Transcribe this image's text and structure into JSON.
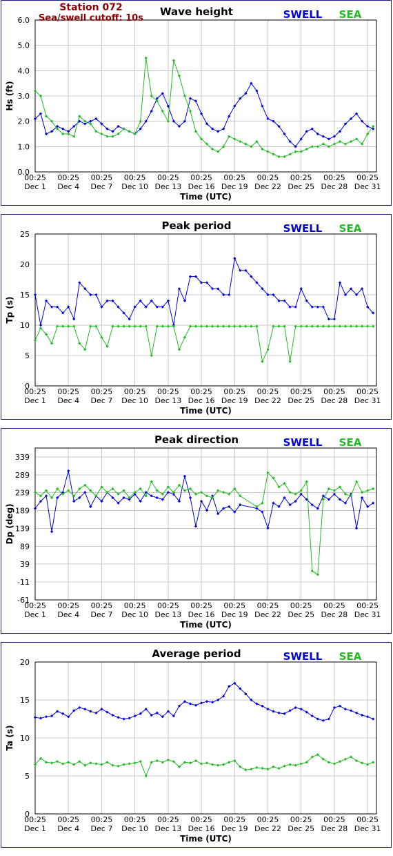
{
  "header": {
    "station": "Station 072",
    "cutoff": "Sea/swell cutoff: 10s"
  },
  "colors": {
    "swell": "#0000dd",
    "sea": "#22bb22"
  },
  "x_tick_labels": [
    [
      "00:25",
      "Dec 1"
    ],
    [
      "00:25",
      "Dec 4"
    ],
    [
      "00:25",
      "Dec 7"
    ],
    [
      "00:25",
      "Dec 10"
    ],
    [
      "00:25",
      "Dec 13"
    ],
    [
      "00:25",
      "Dec 16"
    ],
    [
      "00:25",
      "Dec 19"
    ],
    [
      "00:25",
      "Dec 22"
    ],
    [
      "00:25",
      "Dec 25"
    ],
    [
      "00:25",
      "Dec 28"
    ],
    [
      "00:25",
      "Dec 31"
    ]
  ],
  "chart_data": [
    {
      "type": "line",
      "title": "Wave height",
      "xlabel": "Time (UTC)",
      "ylabel": "Hs (ft)",
      "ylim": [
        0.0,
        6.0
      ],
      "yticks": [
        "0.0",
        "1.0",
        "2.0",
        "3.0",
        "4.0",
        "5.0",
        "6.0"
      ],
      "xlim": [
        0,
        30.8
      ],
      "grid": true,
      "legend": "top-right",
      "series": [
        {
          "name": "SWELL",
          "color": "#0000dd",
          "x": [
            0,
            0.5,
            1,
            1.5,
            2,
            2.5,
            3,
            3.5,
            4,
            4.5,
            5,
            5.5,
            6,
            6.5,
            7,
            7.5,
            8,
            8.5,
            9,
            9.5,
            10,
            10.5,
            11,
            11.5,
            12,
            12.5,
            13,
            13.5,
            14,
            14.5,
            15,
            15.5,
            16,
            16.5,
            17,
            17.5,
            18,
            18.5,
            19,
            19.5,
            20,
            20.5,
            21,
            21.5,
            22,
            22.5,
            23,
            23.5,
            24,
            24.5,
            25,
            25.5,
            26,
            26.5,
            27,
            27.5,
            28,
            28.5,
            29,
            29.5,
            30,
            30.5
          ],
          "y": [
            2.1,
            2.3,
            1.5,
            1.6,
            1.8,
            1.7,
            1.6,
            1.8,
            2.0,
            1.9,
            2.0,
            2.1,
            1.9,
            1.7,
            1.6,
            1.8,
            1.7,
            1.6,
            1.5,
            1.7,
            2.0,
            2.4,
            2.9,
            3.1,
            2.6,
            2.0,
            1.8,
            2.0,
            2.9,
            2.8,
            2.3,
            1.9,
            1.7,
            1.6,
            1.7,
            2.2,
            2.6,
            2.9,
            3.1,
            3.5,
            3.2,
            2.6,
            2.1,
            2.0,
            1.8,
            1.5,
            1.2,
            1.0,
            1.3,
            1.6,
            1.7,
            1.5,
            1.4,
            1.3,
            1.4,
            1.6,
            1.9,
            2.1,
            2.3,
            2.0,
            1.8,
            1.7
          ]
        },
        {
          "name": "SEA",
          "color": "#22bb22",
          "x": [
            0,
            0.5,
            1,
            1.5,
            2,
            2.5,
            3,
            3.5,
            4,
            4.5,
            5,
            5.5,
            6,
            6.5,
            7,
            7.5,
            8,
            8.5,
            9,
            9.5,
            10,
            10.5,
            11,
            11.5,
            12,
            12.5,
            13,
            13.5,
            14,
            14.5,
            15,
            15.5,
            16,
            16.5,
            17,
            17.5,
            18,
            18.5,
            19,
            19.5,
            20,
            20.5,
            21,
            21.5,
            22,
            22.5,
            23,
            23.5,
            24,
            24.5,
            25,
            25.5,
            26,
            26.5,
            27,
            27.5,
            28,
            28.5,
            29,
            29.5,
            30,
            30.5
          ],
          "y": [
            3.2,
            3.0,
            2.2,
            2.0,
            1.7,
            1.5,
            1.5,
            1.4,
            2.2,
            2.0,
            1.9,
            1.6,
            1.5,
            1.4,
            1.4,
            1.5,
            1.7,
            1.6,
            1.5,
            2.0,
            4.5,
            3.0,
            2.8,
            2.4,
            2.0,
            4.4,
            3.8,
            3.0,
            2.4,
            1.6,
            1.3,
            1.1,
            0.9,
            0.8,
            1.0,
            1.4,
            1.3,
            1.2,
            1.1,
            1.0,
            1.2,
            0.9,
            0.8,
            0.7,
            0.6,
            0.6,
            0.7,
            0.8,
            0.8,
            0.9,
            1.0,
            1.0,
            1.1,
            1.0,
            1.1,
            1.2,
            1.1,
            1.2,
            1.3,
            1.1,
            1.5,
            1.8
          ]
        }
      ]
    },
    {
      "type": "line",
      "title": "Peak period",
      "xlabel": "Time (UTC)",
      "ylabel": "Tp (s)",
      "ylim": [
        0,
        25
      ],
      "yticks": [
        "0",
        "5",
        "10",
        "15",
        "20",
        "25"
      ],
      "xlim": [
        0,
        30.8
      ],
      "grid": true,
      "legend": "top-right",
      "series": [
        {
          "name": "SWELL",
          "color": "#0000dd",
          "x": [
            0,
            0.5,
            1,
            1.5,
            2,
            2.5,
            3,
            3.5,
            4,
            4.5,
            5,
            5.5,
            6,
            6.5,
            7,
            7.5,
            8,
            8.5,
            9,
            9.5,
            10,
            10.5,
            11,
            11.5,
            12,
            12.5,
            13,
            13.5,
            14,
            14.5,
            15,
            15.5,
            16,
            16.5,
            17,
            17.5,
            18,
            18.5,
            19,
            19.5,
            20,
            20.5,
            21,
            21.5,
            22,
            22.5,
            23,
            23.5,
            24,
            24.5,
            25,
            25.5,
            26,
            26.5,
            27,
            27.5,
            28,
            28.5,
            29,
            29.5,
            30,
            30.5
          ],
          "y": [
            15,
            10,
            14,
            13,
            13,
            12,
            13,
            11,
            17,
            16,
            15,
            15,
            13,
            14,
            14,
            13,
            12,
            11,
            13,
            14,
            13,
            14,
            13,
            13,
            14,
            10,
            16,
            14,
            18,
            18,
            17,
            17,
            16,
            16,
            15,
            15,
            21,
            19,
            19,
            18,
            17,
            16,
            15,
            15,
            14,
            14,
            13,
            13,
            16,
            14,
            13,
            13,
            13,
            11,
            11,
            17,
            15,
            16,
            15,
            16,
            13,
            12
          ]
        },
        {
          "name": "SEA",
          "color": "#22bb22",
          "x": [
            0,
            0.5,
            1,
            1.5,
            2,
            2.5,
            3,
            3.5,
            4,
            4.5,
            5,
            5.5,
            6,
            6.5,
            7,
            7.5,
            8,
            8.5,
            9,
            9.5,
            10,
            10.5,
            11,
            11.5,
            12,
            12.5,
            13,
            13.5,
            14,
            14.5,
            15,
            15.5,
            16,
            16.5,
            17,
            17.5,
            18,
            18.5,
            19,
            19.5,
            20,
            20.5,
            21,
            21.5,
            22,
            22.5,
            23,
            23.5,
            24,
            24.5,
            25,
            25.5,
            26,
            26.5,
            27,
            27.5,
            28,
            28.5,
            29,
            29.5,
            30,
            30.5
          ],
          "y": [
            7.5,
            9.5,
            8.5,
            7,
            9.8,
            9.8,
            9.8,
            9.8,
            7,
            6,
            9.8,
            9.8,
            8,
            6.5,
            9.8,
            9.8,
            9.8,
            9.8,
            9.8,
            9.8,
            9.8,
            5,
            9.8,
            9.8,
            9.8,
            9.8,
            6,
            8,
            9.8,
            9.8,
            9.8,
            9.8,
            9.8,
            9.8,
            9.8,
            9.8,
            9.8,
            9.8,
            9.8,
            9.8,
            9.8,
            4,
            6,
            9.8,
            9.8,
            9.8,
            4,
            9.8,
            9.8,
            9.8,
            9.8,
            9.8,
            9.8,
            9.8,
            9.8,
            9.8,
            9.8,
            9.8,
            9.8,
            9.8,
            9.8,
            9.8
          ]
        }
      ]
    },
    {
      "type": "line",
      "title": "Peak direction",
      "xlabel": "Time (UTC)",
      "ylabel": "Dp (deg)",
      "ylim": [
        -61,
        364
      ],
      "yticks": [
        "-61",
        "-11",
        "39",
        "89",
        "139",
        "189",
        "239",
        "289",
        "339"
      ],
      "xlim": [
        0,
        30.8
      ],
      "grid": true,
      "legend": "top-right",
      "series": [
        {
          "name": "SWELL",
          "color": "#0000dd",
          "x": [
            0,
            0.5,
            1,
            1.5,
            2,
            2.5,
            3,
            3.5,
            4,
            4.5,
            5,
            5.5,
            6,
            6.5,
            7,
            7.5,
            8,
            8.5,
            9,
            9.5,
            10,
            10.5,
            11,
            11.5,
            12,
            12.5,
            13,
            13.5,
            14,
            14.5,
            15,
            15.5,
            16,
            16.5,
            17,
            17.5,
            18,
            18.5,
            20,
            20.5,
            21,
            21.5,
            22,
            22.5,
            23,
            23.5,
            24,
            24.5,
            25,
            25.5,
            26,
            26.5,
            27,
            27.5,
            28,
            28.5,
            29,
            29.5,
            30,
            30.5
          ],
          "y": [
            195,
            215,
            230,
            130,
            225,
            240,
            300,
            215,
            225,
            240,
            200,
            230,
            215,
            240,
            225,
            210,
            225,
            220,
            235,
            215,
            240,
            230,
            225,
            220,
            240,
            235,
            215,
            285,
            225,
            145,
            215,
            190,
            230,
            180,
            195,
            200,
            185,
            205,
            195,
            185,
            140,
            210,
            200,
            225,
            205,
            215,
            235,
            220,
            205,
            195,
            230,
            220,
            235,
            220,
            210,
            235,
            140,
            225,
            200,
            210
          ]
        },
        {
          "name": "SEA",
          "color": "#22bb22",
          "x": [
            0,
            0.5,
            1,
            1.5,
            2,
            2.5,
            3,
            3.5,
            4,
            4.5,
            5,
            5.5,
            6,
            6.5,
            7,
            7.5,
            8,
            8.5,
            9,
            9.5,
            10,
            10.5,
            11,
            11.5,
            12,
            12.5,
            13,
            13.5,
            14,
            14.5,
            15,
            15.5,
            16,
            16.5,
            17,
            17.5,
            18,
            18.5,
            20,
            20.5,
            21,
            21.5,
            22,
            22.5,
            23,
            23.5,
            24,
            24.5,
            25,
            25.5,
            26,
            26.5,
            27,
            27.5,
            28,
            28.5,
            29,
            29.5,
            30,
            30.5
          ],
          "y": [
            240,
            230,
            245,
            225,
            250,
            235,
            245,
            230,
            250,
            260,
            245,
            230,
            255,
            240,
            250,
            235,
            245,
            225,
            240,
            250,
            230,
            270,
            245,
            235,
            255,
            240,
            260,
            245,
            250,
            235,
            240,
            230,
            225,
            245,
            240,
            235,
            250,
            230,
            200,
            210,
            295,
            280,
            255,
            265,
            240,
            235,
            245,
            270,
            20,
            10,
            220,
            250,
            245,
            255,
            235,
            230,
            270,
            240,
            245,
            250
          ]
        }
      ]
    },
    {
      "type": "line",
      "title": "Average period",
      "xlabel": "Time (UTC)",
      "ylabel": "Ta (s)",
      "ylim": [
        0,
        20
      ],
      "yticks": [
        "0",
        "5",
        "10",
        "15",
        "20"
      ],
      "xlim": [
        0,
        30.8
      ],
      "grid": true,
      "legend": "top-right",
      "series": [
        {
          "name": "SWELL",
          "color": "#0000dd",
          "x": [
            0,
            0.5,
            1,
            1.5,
            2,
            2.5,
            3,
            3.5,
            4,
            4.5,
            5,
            5.5,
            6,
            6.5,
            7,
            7.5,
            8,
            8.5,
            9,
            9.5,
            10,
            10.5,
            11,
            11.5,
            12,
            12.5,
            13,
            13.5,
            14,
            14.5,
            15,
            15.5,
            16,
            16.5,
            17,
            17.5,
            18,
            18.5,
            19,
            19.5,
            20,
            20.5,
            21,
            21.5,
            22,
            22.5,
            23,
            23.5,
            24,
            24.5,
            25,
            25.5,
            26,
            26.5,
            27,
            27.5,
            28,
            28.5,
            29,
            29.5,
            30,
            30.5
          ],
          "y": [
            12.7,
            12.6,
            12.8,
            12.9,
            13.5,
            13.2,
            12.8,
            13.6,
            14.0,
            13.8,
            13.5,
            13.3,
            13.8,
            13.4,
            13.0,
            12.7,
            12.5,
            12.6,
            12.9,
            13.2,
            13.8,
            13.0,
            13.3,
            12.8,
            13.5,
            12.9,
            14.2,
            14.8,
            14.5,
            14.3,
            14.6,
            14.8,
            14.7,
            15.0,
            15.5,
            16.8,
            17.2,
            16.5,
            15.8,
            15.0,
            14.5,
            14.2,
            13.8,
            13.5,
            13.3,
            13.2,
            13.6,
            14.0,
            13.8,
            13.4,
            12.9,
            12.5,
            12.3,
            12.5,
            14.0,
            14.2,
            13.8,
            13.6,
            13.3,
            13.0,
            12.8,
            12.5
          ]
        },
        {
          "name": "SEA",
          "color": "#22bb22",
          "x": [
            0,
            0.5,
            1,
            1.5,
            2,
            2.5,
            3,
            3.5,
            4,
            4.5,
            5,
            5.5,
            6,
            6.5,
            7,
            7.5,
            8,
            8.5,
            9,
            9.5,
            10,
            10.5,
            11,
            11.5,
            12,
            12.5,
            13,
            13.5,
            14,
            14.5,
            15,
            15.5,
            16,
            16.5,
            17,
            17.5,
            18,
            18.5,
            19,
            19.5,
            20,
            20.5,
            21,
            21.5,
            22,
            22.5,
            23,
            23.5,
            24,
            24.5,
            25,
            25.5,
            26,
            26.5,
            27,
            27.5,
            28,
            28.5,
            29,
            29.5,
            30,
            30.5
          ],
          "y": [
            6.5,
            7.3,
            6.8,
            6.7,
            6.9,
            6.6,
            6.8,
            6.5,
            6.9,
            6.4,
            6.7,
            6.6,
            6.5,
            6.8,
            6.4,
            6.3,
            6.5,
            6.6,
            6.7,
            6.9,
            5.0,
            6.8,
            7.0,
            6.8,
            7.1,
            6.9,
            6.2,
            6.8,
            6.7,
            7.0,
            6.6,
            6.7,
            6.5,
            6.4,
            6.5,
            6.8,
            7.0,
            6.2,
            5.8,
            5.9,
            6.1,
            6.0,
            5.9,
            6.2,
            6.0,
            6.3,
            6.5,
            6.4,
            6.6,
            6.8,
            7.5,
            7.8,
            7.2,
            6.8,
            6.6,
            6.9,
            7.2,
            7.5,
            7.0,
            6.7,
            6.5,
            6.8
          ]
        }
      ]
    }
  ]
}
